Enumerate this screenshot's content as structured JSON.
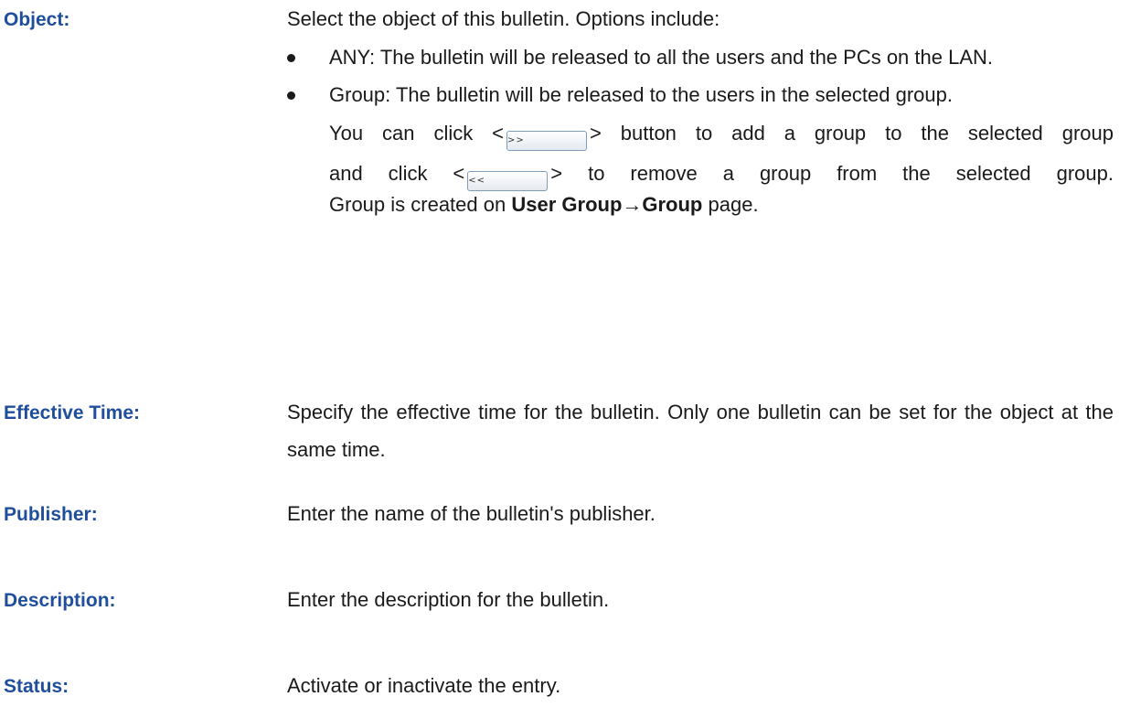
{
  "colors": {
    "term": "#1f4e9c",
    "text": "#1a1a1a",
    "button_border": "#7f9db9"
  },
  "entries": [
    {
      "term": "Object:",
      "intro": "Select the object of this bulletin. Options include:",
      "options": [
        {
          "name": "ANY",
          "text": "ANY: The bulletin will be released to all the users and the PCs on the LAN."
        },
        {
          "name": "Group",
          "text": "Group: The bulletin will be released to the users in the selected group.",
          "add_prefix": "You can click <",
          "add_button_label": ">>",
          "add_suffix": "> button to add a group to the selected group",
          "remove_prefix": "and click <",
          "remove_button_label": "<<",
          "remove_suffix": "> to remove a group from the selected group.",
          "created_prefix": "Group is created on",
          "created_path": "User Group→Group",
          "created_suffix": "page."
        }
      ]
    },
    {
      "term": "Effective Time:",
      "text": "Specify the effective time for the bulletin. Only one bulletin can be set for the object at the same time."
    },
    {
      "term": "Publisher:",
      "text": "Enter the name of the bulletin's publisher."
    },
    {
      "term": "Description:",
      "text": "Enter the description for the bulletin."
    },
    {
      "term": "Status:",
      "text": "Activate or inactivate the entry."
    }
  ]
}
